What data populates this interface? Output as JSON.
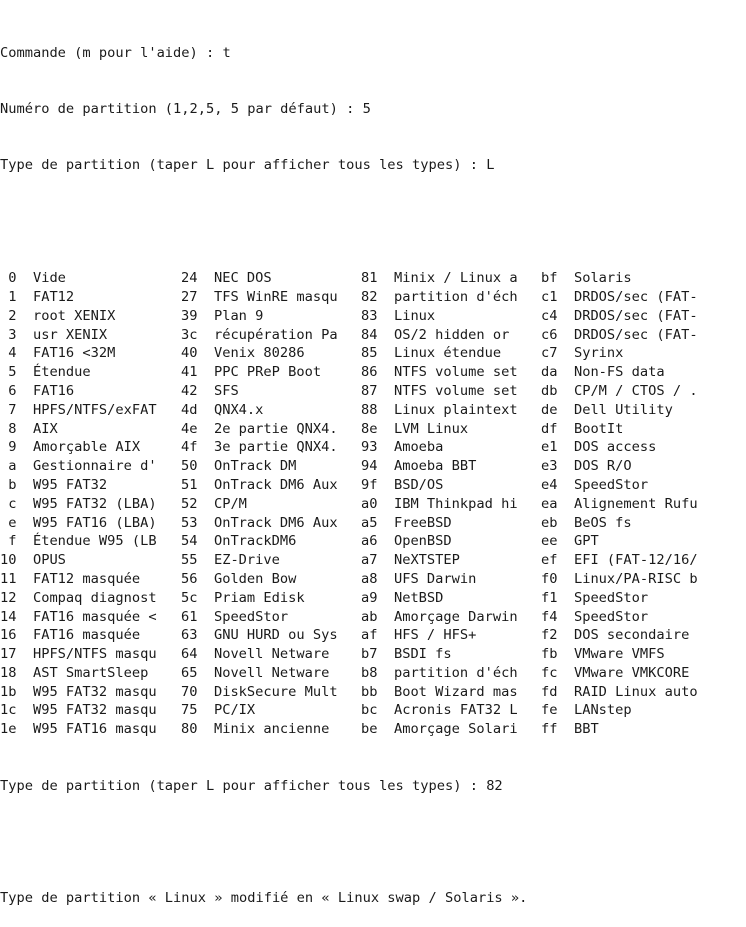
{
  "prompts": {
    "command": "Commande (m pour l'aide) : t",
    "partition_number": "Numéro de partition (1,2,5, 5 par défaut) : 5",
    "type_request_1": "Type de partition (taper L pour afficher tous les types) : L",
    "type_request_2": "Type de partition (taper L pour afficher tous les types) : 82",
    "result": "Type de partition « Linux » modifié en « Linux swap / Solaris »."
  },
  "partition_table": [
    [
      " 0  Vide",
      "24  NEC DOS",
      "81  Minix / Linux a",
      "bf  Solaris"
    ],
    [
      " 1  FAT12",
      "27  TFS WinRE masqu",
      "82  partition d'éch",
      "c1  DRDOS/sec (FAT-"
    ],
    [
      " 2  root XENIX",
      "39  Plan 9",
      "83  Linux",
      "c4  DRDOS/sec (FAT-"
    ],
    [
      " 3  usr XENIX",
      "3c  récupération Pa",
      "84  OS/2 hidden or",
      "c6  DRDOS/sec (FAT-"
    ],
    [
      " 4  FAT16 <32M",
      "40  Venix 80286",
      "85  Linux étendue",
      "c7  Syrinx"
    ],
    [
      " 5  Étendue",
      "41  PPC PReP Boot",
      "86  NTFS volume set",
      "da  Non-FS data"
    ],
    [
      " 6  FAT16",
      "42  SFS",
      "87  NTFS volume set",
      "db  CP/M / CTOS / ."
    ],
    [
      " 7  HPFS/NTFS/exFAT",
      "4d  QNX4.x",
      "88  Linux plaintext",
      "de  Dell Utility"
    ],
    [
      " 8  AIX",
      "4e  2e partie QNX4.",
      "8e  LVM Linux",
      "df  BootIt"
    ],
    [
      " 9  Amorçable AIX",
      "4f  3e partie QNX4.",
      "93  Amoeba",
      "e1  DOS access"
    ],
    [
      " a  Gestionnaire d'",
      "50  OnTrack DM",
      "94  Amoeba BBT",
      "e3  DOS R/O"
    ],
    [
      " b  W95 FAT32",
      "51  OnTrack DM6 Aux",
      "9f  BSD/OS",
      "e4  SpeedStor"
    ],
    [
      " c  W95 FAT32 (LBA)",
      "52  CP/M",
      "a0  IBM Thinkpad hi",
      "ea  Alignement Rufu"
    ],
    [
      " e  W95 FAT16 (LBA)",
      "53  OnTrack DM6 Aux",
      "a5  FreeBSD",
      "eb  BeOS fs"
    ],
    [
      " f  Étendue W95 (LB",
      "54  OnTrackDM6",
      "a6  OpenBSD",
      "ee  GPT"
    ],
    [
      "10  OPUS",
      "55  EZ-Drive",
      "a7  NeXTSTEP",
      "ef  EFI (FAT-12/16/"
    ],
    [
      "11  FAT12 masquée",
      "56  Golden Bow",
      "a8  UFS Darwin",
      "f0  Linux/PA-RISC b"
    ],
    [
      "12  Compaq diagnost",
      "5c  Priam Edisk",
      "a9  NetBSD",
      "f1  SpeedStor"
    ],
    [
      "14  FAT16 masquée <",
      "61  SpeedStor",
      "ab  Amorçage Darwin",
      "f4  SpeedStor"
    ],
    [
      "16  FAT16 masquée",
      "63  GNU HURD ou Sys",
      "af  HFS / HFS+",
      "f2  DOS secondaire"
    ],
    [
      "17  HPFS/NTFS masqu",
      "64  Novell Netware",
      "b7  BSDI fs",
      "fb  VMware VMFS"
    ],
    [
      "18  AST SmartSleep",
      "65  Novell Netware",
      "b8  partition d'éch",
      "fc  VMware VMKCORE"
    ],
    [
      "1b  W95 FAT32 masqu",
      "70  DiskSecure Mult",
      "bb  Boot Wizard mas",
      "fd  RAID Linux auto"
    ],
    [
      "1c  W95 FAT32 masqu",
      "75  PC/IX",
      "bc  Acronis FAT32 L",
      "fe  LANstep"
    ],
    [
      "1e  W95 FAT16 masqu",
      "80  Minix ancienne",
      "be  Amorçage Solari",
      "ff  BBT"
    ]
  ],
  "colors": {
    "background": "#ffffff",
    "text": "#1a1a1a"
  }
}
